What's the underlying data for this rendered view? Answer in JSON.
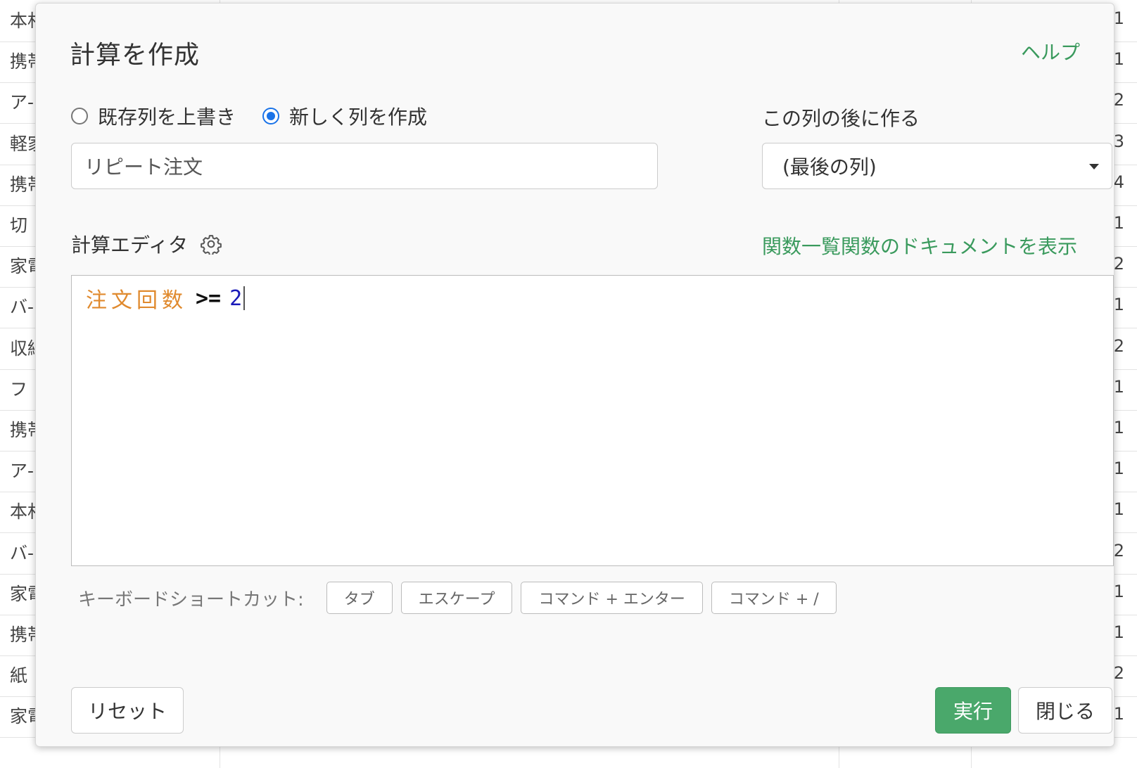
{
  "background_sheet": {
    "left_cells": [
      "本村",
      "携帯",
      "ア-",
      "軽家",
      "携帯",
      "切",
      "家電",
      "バ-",
      "収納",
      "フ",
      "携帯",
      "ア-",
      "本村",
      "バ-",
      "家電",
      "携帯",
      "紙",
      "家電"
    ],
    "right_cells": [
      "1",
      "1",
      "2",
      "3",
      "4",
      "1",
      "2",
      "1",
      "2",
      "1",
      "1",
      "1",
      "1",
      "2",
      "1",
      "1",
      "2",
      "1"
    ]
  },
  "modal": {
    "title": "計算を作成",
    "help_label": "ヘルプ",
    "mode_options": [
      {
        "label": "既存列を上書き",
        "checked": false
      },
      {
        "label": "新しく列を作成",
        "checked": true
      }
    ],
    "column_name": {
      "value": "リピート注文"
    },
    "position": {
      "label": "この列の後に作る",
      "selected": "(最後の列)"
    },
    "editor": {
      "label": "計算エディタ",
      "function_list_link": "関数一覧",
      "function_doc_link": "関数のドキュメントを表示",
      "code": {
        "column": "注文回数",
        "operator": ">=",
        "number": "2"
      }
    },
    "shortcuts": {
      "label": "キーボードショートカット:",
      "keys": [
        "タブ",
        "エスケープ",
        "コマンド + エンター",
        "コマンド + /"
      ]
    },
    "buttons": {
      "reset": "リセット",
      "run": "実行",
      "close": "閉じる"
    },
    "colors": {
      "accent_green": "#4aa86b",
      "link_green": "#3a9a5d",
      "radio_blue": "#1a73e8",
      "code_column": "#e08a2e",
      "code_number": "#1a1ab8"
    }
  }
}
